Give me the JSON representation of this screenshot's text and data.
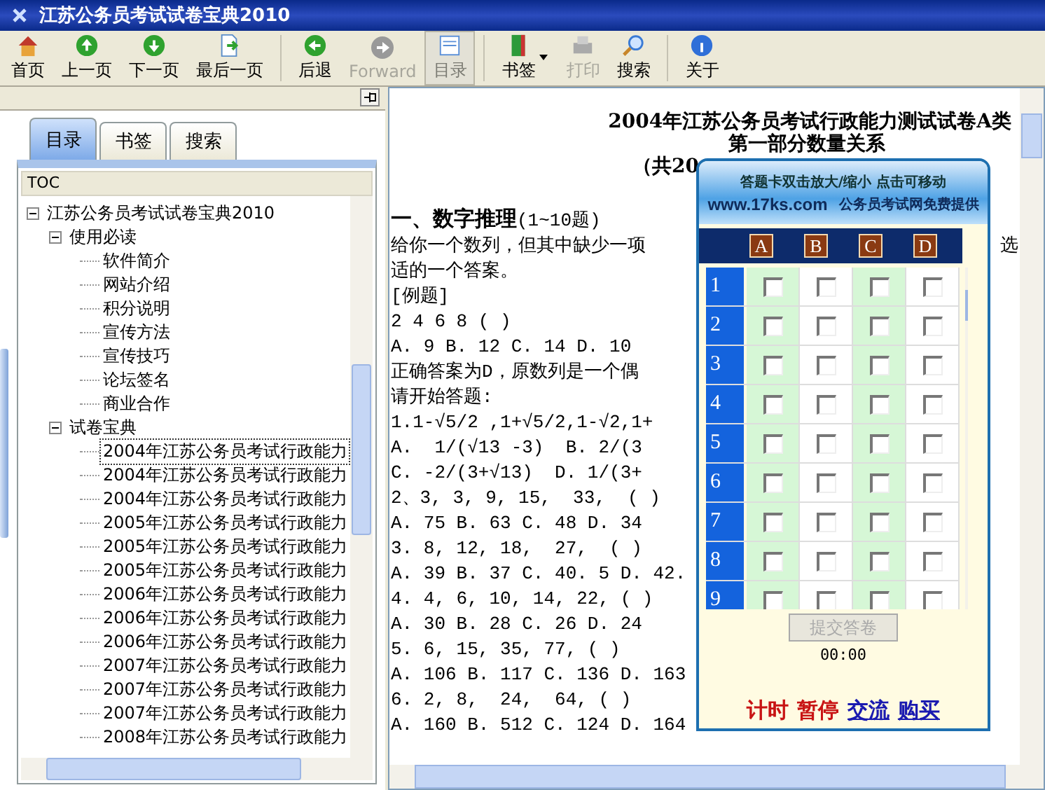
{
  "window": {
    "title": "江苏公务员考试试卷宝典2010"
  },
  "toolbar": [
    {
      "label": "首页",
      "disabled": false,
      "pressed": false
    },
    {
      "label": "上一页",
      "disabled": false,
      "pressed": false
    },
    {
      "label": "下一页",
      "disabled": false,
      "pressed": false
    },
    {
      "label": "最后一页",
      "disabled": false,
      "pressed": false
    },
    {
      "label": "后退",
      "disabled": false,
      "pressed": false
    },
    {
      "label": "Forward",
      "disabled": true,
      "pressed": false
    },
    {
      "label": "目录",
      "disabled": true,
      "pressed": true
    },
    {
      "label": "书签",
      "disabled": false,
      "pressed": false,
      "dropdown": true
    },
    {
      "label": "打印",
      "disabled": true,
      "pressed": false
    },
    {
      "label": "搜索",
      "disabled": false,
      "pressed": false
    },
    {
      "label": "关于",
      "disabled": false,
      "pressed": false
    }
  ],
  "sidebar": {
    "tabs": [
      {
        "label": "目录",
        "selected": true
      },
      {
        "label": "书签",
        "selected": false
      },
      {
        "label": "搜索",
        "selected": false
      }
    ],
    "tree_header": "TOC",
    "tree": [
      {
        "label": "江苏公务员考试试卷宝典2010",
        "expanded": true,
        "selected": false,
        "children": [
          {
            "label": "使用必读",
            "expanded": true,
            "selected": false,
            "children": [
              {
                "label": "软件简介",
                "selected": false
              },
              {
                "label": "网站介绍",
                "selected": false
              },
              {
                "label": "积分说明",
                "selected": false
              },
              {
                "label": "宣传方法",
                "selected": false
              },
              {
                "label": "宣传技巧",
                "selected": false
              },
              {
                "label": "论坛签名",
                "selected": false
              },
              {
                "label": "商业合作",
                "selected": false
              }
            ]
          },
          {
            "label": "试卷宝典",
            "expanded": true,
            "selected": false,
            "children": [
              {
                "label": "2004年江苏公务员考试行政能力",
                "selected": true
              },
              {
                "label": "2004年江苏公务员考试行政能力",
                "selected": false
              },
              {
                "label": "2004年江苏公务员考试行政能力",
                "selected": false
              },
              {
                "label": "2005年江苏公务员考试行政能力",
                "selected": false
              },
              {
                "label": "2005年江苏公务员考试行政能力",
                "selected": false
              },
              {
                "label": "2005年江苏公务员考试行政能力",
                "selected": false
              },
              {
                "label": "2006年江苏公务员考试行政能力",
                "selected": false
              },
              {
                "label": "2006年江苏公务员考试行政能力",
                "selected": false
              },
              {
                "label": "2006年江苏公务员考试行政能力",
                "selected": false
              },
              {
                "label": "2007年江苏公务员考试行政能力",
                "selected": false
              },
              {
                "label": "2007年江苏公务员考试行政能力",
                "selected": false
              },
              {
                "label": "2007年江苏公务员考试行政能力",
                "selected": false
              },
              {
                "label": "2008年江苏公务员考试行政能力",
                "selected": false
              }
            ]
          }
        ]
      }
    ]
  },
  "document": {
    "titles": [
      "2004年江苏公务员考试行政能力测试试卷A类",
      "第一部分数量关系",
      "（共20"
    ],
    "lines": [
      {
        "text": "**一、数字推理**(1~10题)"
      },
      {
        "text": "给你一个数列，但其中缺少一项",
        "tail": "选"
      },
      {
        "text": "适的一个答案。"
      },
      {
        "text": "[例题]"
      },
      {
        "text": "2 4 6 8 ( )"
      },
      {
        "text": "A. 9 B. 12 C. 14 D. 10"
      },
      {
        "text": "正确答案为D，原数列是一个偶"
      },
      {
        "text": "请开始答题:"
      },
      {
        "text": "1.1-√5/2 ,1+√5/2,1-√2,1+"
      },
      {
        "text": "A.  1/(√13 -3)  B. 2/(3"
      },
      {
        "text": "C. -2/(3+√13)  D. 1/(3+"
      },
      {
        "text": "2、3, 3, 9, 15,  33,  ( )"
      },
      {
        "text": "A. 75 B. 63 C. 48 D. 34"
      },
      {
        "text": "3. 8, 12, 18,  27,  ( )"
      },
      {
        "text": "A. 39 B. 37 C. 40. 5 D. 42."
      },
      {
        "text": "4. 4, 6, 10, 14, 22, ( )"
      },
      {
        "text": "A. 30 B. 28 C. 26 D. 24"
      },
      {
        "text": "5. 6, 15, 35, 77, ( )"
      },
      {
        "text": "A. 106 B. 117 C. 136 D. 163"
      },
      {
        "text": "6. 2, 8,  24,  64, ( )"
      },
      {
        "text": "A. 160 B. 512 C. 124 D. 164"
      }
    ]
  },
  "answer_card": {
    "hint": "答题卡双击放大/缩小 点击可移动",
    "site": "www.17ks.com",
    "provider": "公务员考试网免费提供",
    "columns": [
      "A",
      "B",
      "C",
      "D"
    ],
    "rows": [
      {
        "number": "1",
        "options": [
          {
            "checked": false
          },
          {
            "checked": false
          },
          {
            "checked": false
          },
          {
            "checked": false
          }
        ]
      },
      {
        "number": "2",
        "options": [
          {
            "checked": false
          },
          {
            "checked": false
          },
          {
            "checked": false
          },
          {
            "checked": false
          }
        ]
      },
      {
        "number": "3",
        "options": [
          {
            "checked": false
          },
          {
            "checked": false
          },
          {
            "checked": false
          },
          {
            "checked": false
          }
        ]
      },
      {
        "number": "4",
        "options": [
          {
            "checked": false
          },
          {
            "checked": false
          },
          {
            "checked": false
          },
          {
            "checked": false
          }
        ]
      },
      {
        "number": "5",
        "options": [
          {
            "checked": false
          },
          {
            "checked": false
          },
          {
            "checked": false
          },
          {
            "checked": false
          }
        ]
      },
      {
        "number": "6",
        "options": [
          {
            "checked": false
          },
          {
            "checked": false
          },
          {
            "checked": false
          },
          {
            "checked": false
          }
        ]
      },
      {
        "number": "7",
        "options": [
          {
            "checked": false
          },
          {
            "checked": false
          },
          {
            "checked": false
          },
          {
            "checked": false
          }
        ]
      },
      {
        "number": "8",
        "options": [
          {
            "checked": false
          },
          {
            "checked": false
          },
          {
            "checked": false
          },
          {
            "checked": false
          }
        ]
      },
      {
        "number": "9",
        "options": [
          {
            "checked": false
          },
          {
            "checked": false
          },
          {
            "checked": false
          },
          {
            "checked": false
          }
        ]
      }
    ],
    "submit": {
      "label": "提交答卷",
      "disabled": true
    },
    "timer": "00:00",
    "links": [
      {
        "label": "计时",
        "kind": "action"
      },
      {
        "label": "暂停",
        "kind": "action"
      },
      {
        "label": "交流",
        "kind": "link"
      },
      {
        "label": "购买",
        "kind": "link"
      }
    ]
  }
}
